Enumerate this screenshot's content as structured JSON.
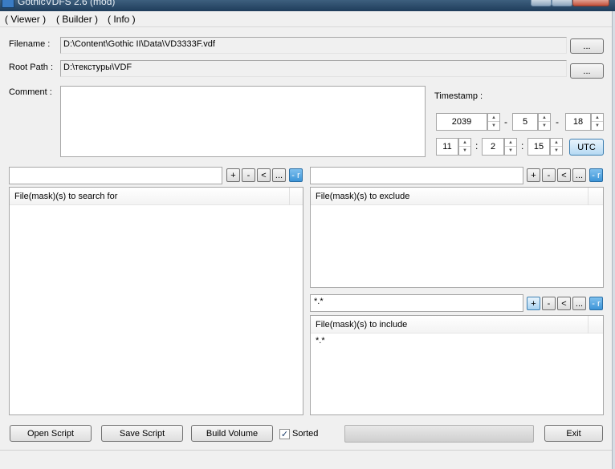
{
  "window": {
    "title": "GothicVDFS 2.6 (mod)"
  },
  "menu": {
    "items": [
      "( Viewer )",
      "( Builder )",
      "( Info )"
    ]
  },
  "form": {
    "filename_label": "Filename :",
    "filename_value": "D:\\Content\\Gothic II\\Data\\VD3333F.vdf",
    "rootpath_label": "Root Path :",
    "rootpath_value": "D:\\текстуры\\VDF",
    "comment_label": "Comment :",
    "browse_label": "...",
    "timestamp_label": "Timestamp :",
    "year": "2039",
    "month": "5",
    "day": "18",
    "hour": "11",
    "minute": "2",
    "second": "15",
    "date_sep": "-",
    "time_sep": ":",
    "utc_label": "UTC"
  },
  "list_buttons": {
    "add": "+",
    "remove": "-",
    "back": "<",
    "more": "...",
    "recursive": "- r"
  },
  "panels": {
    "search": {
      "input_value": "",
      "header": "File(mask)(s) to search for",
      "rows": []
    },
    "exclude": {
      "input_value": "",
      "header": "File(mask)(s) to exclude",
      "rows": []
    },
    "include": {
      "input_value": "*.*",
      "header": "File(mask)(s) to include",
      "rows": [
        "*.*"
      ]
    }
  },
  "bottom": {
    "open_script": "Open Script",
    "save_script": "Save Script",
    "build_volume": "Build Volume",
    "sorted_label": "Sorted",
    "sorted_checked": true,
    "progress": 0,
    "exit": "Exit"
  },
  "icons": {
    "spin_up": "▲",
    "spin_down": "▼",
    "check": "✓"
  }
}
